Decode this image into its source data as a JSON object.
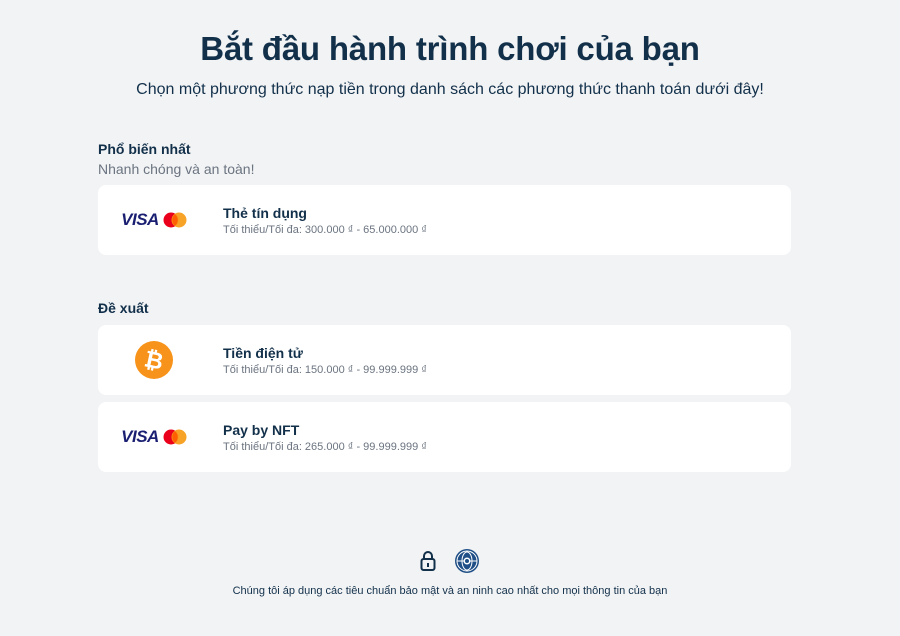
{
  "header": {
    "title": "Bắt đầu hành trình chơi của bạn",
    "subtitle": "Chọn một phương thức nạp tiền trong danh sách các phương thức thanh toán dưới đây!"
  },
  "popular": {
    "title": "Phổ biến nhất",
    "subtitle": "Nhanh chóng và an toàn!",
    "methods": [
      {
        "name": "Thẻ tín dụng",
        "limit": "Tối thiểu/Tối đa: 300.000 ₫ - 65.000.000 ₫",
        "logo_text": "VISA",
        "icon": "visa-mastercard-icon"
      }
    ]
  },
  "recommended": {
    "title": "Đề xuất",
    "methods": [
      {
        "name": "Tiền điện tử",
        "limit": "Tối thiểu/Tối đa: 150.000 ₫ - 99.999.999 ₫",
        "logo_text": "₿",
        "icon": "bitcoin-icon"
      },
      {
        "name": "Pay by NFT",
        "limit": "Tối thiểu/Tối đa: 265.000 ₫ - 99.999.999 ₫",
        "logo_text": "VISA",
        "icon": "visa-mastercard-icon"
      }
    ]
  },
  "footer": {
    "text": "Chúng tôi áp dụng các tiêu chuẩn bảo mật và an ninh cao nhất cho mọi thông tin của bạn",
    "icons": [
      "lock-icon",
      "security-seal-icon"
    ]
  },
  "colors": {
    "background": "#f2f3f5",
    "text_dark": "#12304a",
    "text_muted": "#6b7480",
    "visa_blue": "#1a1f71",
    "mastercard_red": "#eb001b",
    "mastercard_orange": "#f79e1b",
    "bitcoin_orange": "#f7931a"
  }
}
